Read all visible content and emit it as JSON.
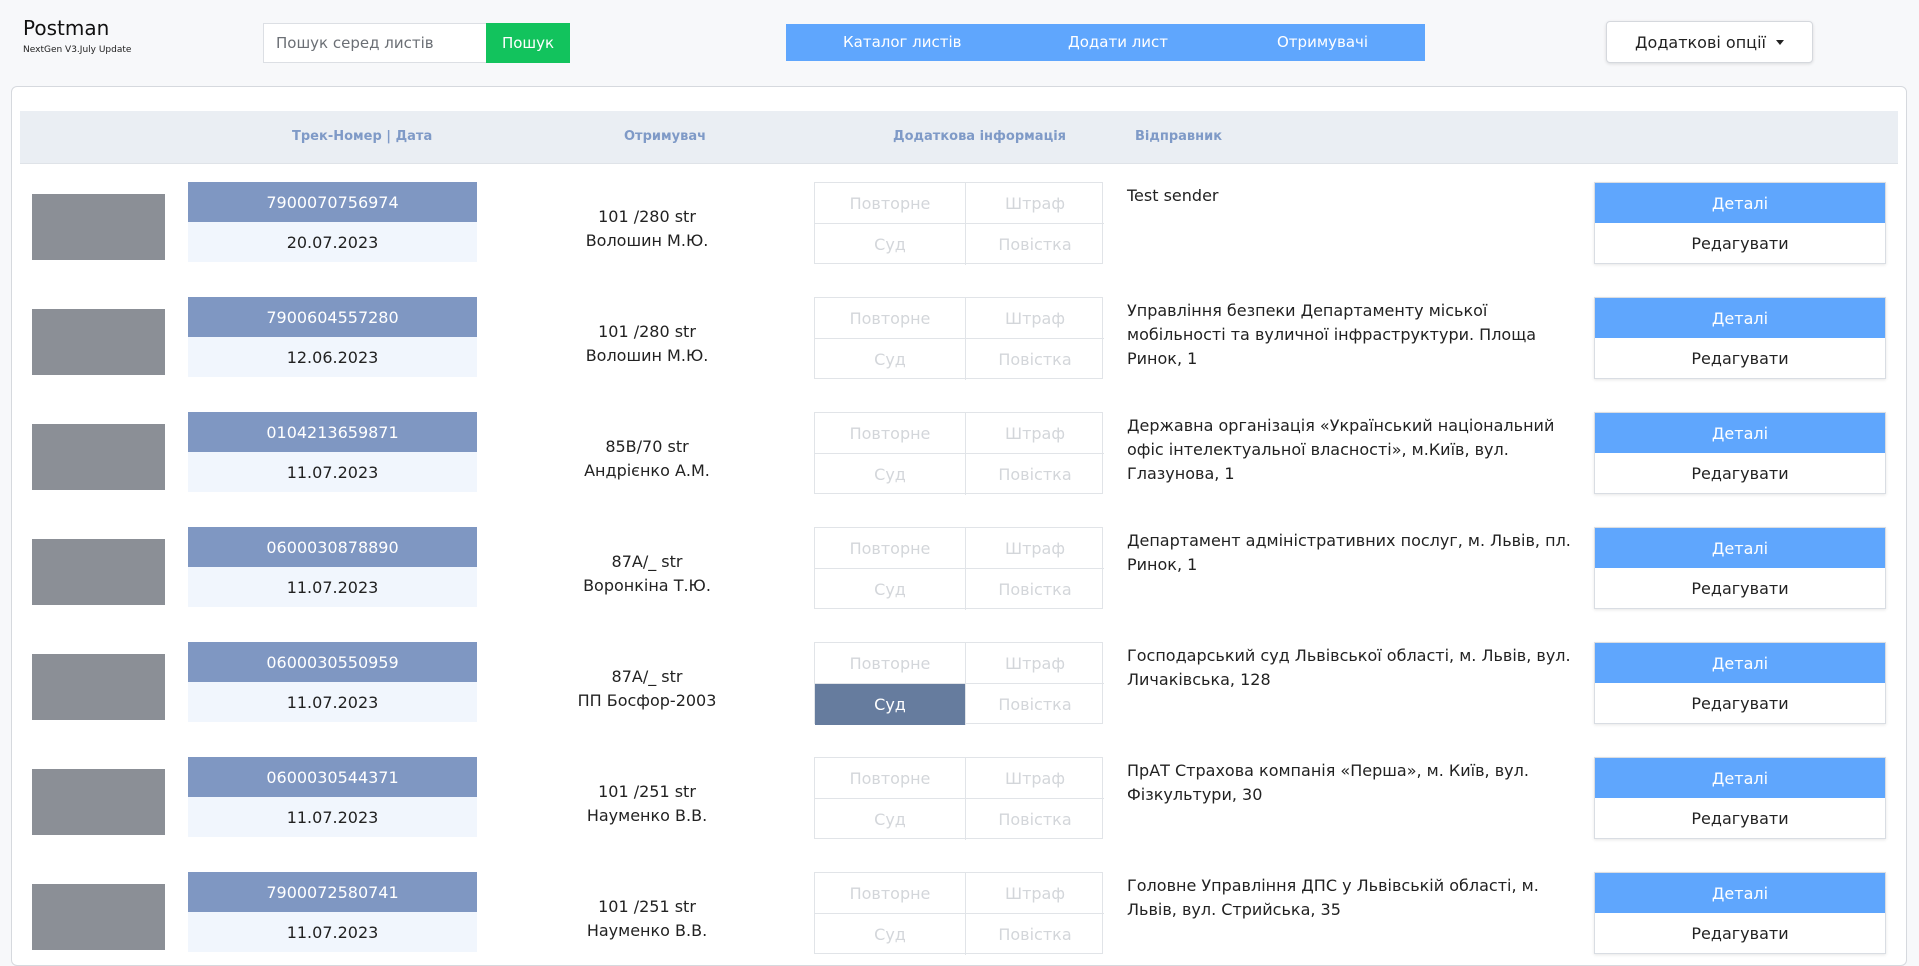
{
  "brand": {
    "title": "Postman",
    "subtitle": "NextGen V3.July Update"
  },
  "search": {
    "placeholder": "Пошук серед листів",
    "button_label": "Пошук"
  },
  "nav": {
    "items": [
      {
        "label": "Каталог листів"
      },
      {
        "label": "Додати лист"
      },
      {
        "label": "Отримувачі"
      }
    ],
    "color": "#5fa6fd"
  },
  "options": {
    "label": "Додаткові опції"
  },
  "table": {
    "headers": {
      "track_date": "Трек-Номер | Дата",
      "recipient": "Отримувач",
      "extra": "Додаткова інформація",
      "sender": "Відправник"
    },
    "flag_labels": [
      "Повторне",
      "Штраф",
      "Суд",
      "Повістка"
    ],
    "details_label": "Деталі",
    "edit_label": "Редагувати",
    "rows": [
      {
        "track": "7900070756974",
        "date": "20.07.2023",
        "address": "101 /280 str",
        "recipient": "Волошин М.Ю.",
        "active_flags": [],
        "sender": "Test sender"
      },
      {
        "track": "7900604557280",
        "date": "12.06.2023",
        "address": "101 /280 str",
        "recipient": "Волошин М.Ю.",
        "active_flags": [],
        "sender": "Управління безпеки Департаменту міської мобільності та вуличної інфраструктури. Площа Ринок, 1"
      },
      {
        "track": "0104213659871",
        "date": "11.07.2023",
        "address": "85B/70 str",
        "recipient": "Андрієнко А.М.",
        "active_flags": [],
        "sender": "Державна організація «Український національний офіс інтелектуальної власності», м.Київ, вул. Глазунова, 1"
      },
      {
        "track": "0600030878890",
        "date": "11.07.2023",
        "address": "87A/_ str",
        "recipient": "Воронкіна Т.Ю.",
        "active_flags": [],
        "sender": "Департамент адміністративних послуг, м. Львів, пл. Ринок, 1"
      },
      {
        "track": "0600030550959",
        "date": "11.07.2023",
        "address": "87A/_ str",
        "recipient": "ПП Босфор-2003",
        "active_flags": [
          "Суд"
        ],
        "sender": "Господарський суд Львівської області, м. Львів, вул. Личаківська, 128"
      },
      {
        "track": "0600030544371",
        "date": "11.07.2023",
        "address": "101 /251 str",
        "recipient": "Науменко В.В.",
        "active_flags": [],
        "sender": "ПрАТ Страхова компанія «Перша», м. Київ, вул. Фізкультури, 30"
      },
      {
        "track": "7900072580741",
        "date": "11.07.2023",
        "address": "101 /251 str",
        "recipient": "Науменко В.В.",
        "active_flags": [],
        "sender": "Головне Управління ДПС у Львівській області, м. Львів, вул. Стрийська, 35"
      }
    ]
  }
}
